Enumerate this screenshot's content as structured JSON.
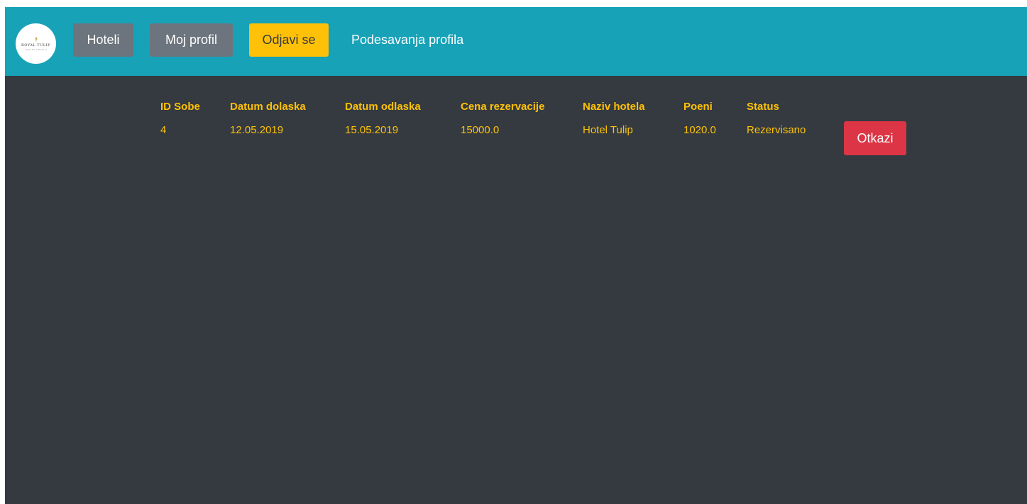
{
  "logo": {
    "brand": "ROYAL TULIP",
    "tagline": "LUXURY HOTELS",
    "mark_color": "#c9a24a"
  },
  "navbar": {
    "hoteli_label": "Hoteli",
    "moj_profil_label": "Moj profil",
    "odjavi_label": "Odjavi se",
    "podesavanja_label": "Podesavanja profila",
    "colors": {
      "navbar_bg": "#17a2b8",
      "secondary": "#6c757d",
      "warning": "#ffc107"
    }
  },
  "table": {
    "headers": {
      "id_sobe": "ID Sobe",
      "datum_dolaska": "Datum dolaska",
      "datum_odlaska": "Datum odlaska",
      "cena": "Cena rezervacije",
      "naziv_hotela": "Naziv hotela",
      "poeni": "Poeni",
      "status": "Status"
    },
    "rows": [
      {
        "id_sobe": "4",
        "datum_dolaska": "12.05.2019",
        "datum_odlaska": "15.05.2019",
        "cena": "15000.0",
        "naziv_hotela": "Hotel Tulip",
        "poeni": "1020.0",
        "status": "Rezervisano",
        "action_label": "Otkazi"
      }
    ],
    "colors": {
      "text": "#ffc107",
      "danger": "#dc3545",
      "page_bg": "#343a40"
    }
  }
}
